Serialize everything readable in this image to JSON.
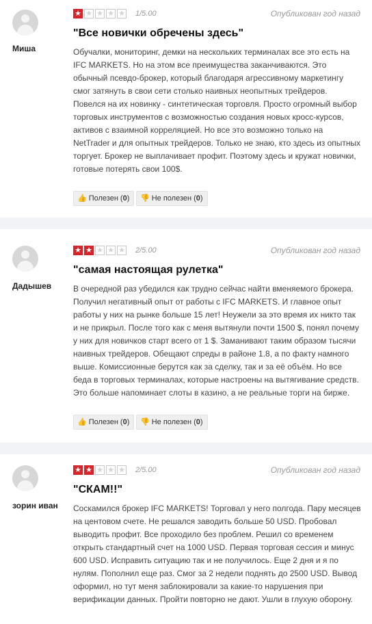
{
  "published_label": "Опубликован год назад",
  "helpful_label": "Полезен",
  "not_helpful_label": "Не полезен",
  "star_glyph": "★",
  "accent_color": "#d8232a",
  "reviews": [
    {
      "author": "Миша",
      "rating": 1,
      "rating_text": "1/5.00",
      "title": "\"Все новички обречены здесь\"",
      "text": "Обучалки, мониторинг, демки на нескольких терминалах все это есть на IFC MARKETS. Но на этом все преимущества заканчиваются. Это обычный псевдо-брокер, который благодаря агрессивному маркетингу смог затянуть в свои сети столько наивных неопытных трейдеров. Повелся на их новинку - синтетическая торговля. Просто огромный выбор торговых инструментов с возможностью создания новых кросс-курсов, активов с взаимной корреляцией. Но все это возможно только на NetTrader и для опытных трейдеров. Только не знаю, кто здесь из опытных торгует. Брокер не выплачивает профит. Поэтому здесь и кружат новички, готовые потерять свои 100$.",
      "helpful_count": "0",
      "not_helpful_count": "0"
    },
    {
      "author": "Дадышев",
      "rating": 2,
      "rating_text": "2/5.00",
      "title": "\"самая настоящая рулетка\"",
      "text": "В очередной раз убедился как трудно сейчас найти вменяемого брокера. Получил негативный опыт от работы с IFC MARKETS. И главное опыт работы у них на рынке больше 15 лет! Неужели за это время их никто так и не прикрыл. После того как с меня вытянули почти 1500 $, понял почему у них для новичков старт всего от 1 $. Заманивают таким образом тысячи наивных трейдеров. Обещают спреды в районе 1.8, а по факту намного выше. Комиссионные берутся как за сделку, так и за её объём. Но все беда в торговых терминалах, которые настроены на вытягивание средств. Это больше напоминает слоты в казино, а не реальные торги на бирже.",
      "helpful_count": "0",
      "not_helpful_count": "0"
    },
    {
      "author": "зорин иван",
      "rating": 2,
      "rating_text": "2/5.00",
      "title": "\"СКАМ!!\"",
      "text": "Соскамился брокер IFC MARKETS! Торговал у него полгода. Пару месяцев на центовом счете. Не решался заводить больше 50 USD. Пробовал выводить профит. Все проходило без проблем. Решил со временем открыть стандартный счет на 1000 USD. Первая торговая сессия и минус 600 USD. Исправить ситуацию так и не получилось. Еще 2 дня и я по нулям. Пополнил еще раз. Смог за 2 недели поднять до 2500 USD. Вывод оформил, но тут меня заблокировали за какие-то нарушения при верификации данных. Пройти повторно не дают. Ушли в глухую оборону."
    }
  ]
}
